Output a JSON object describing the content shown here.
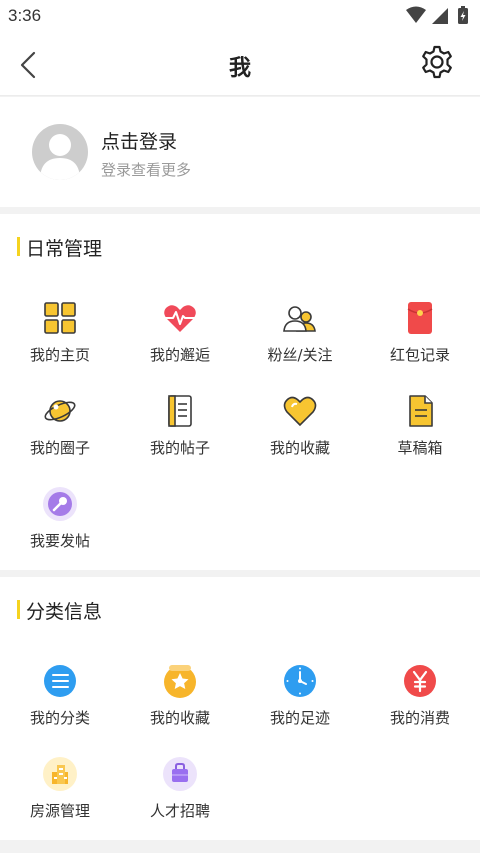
{
  "status_bar": {
    "time": "3:36"
  },
  "nav": {
    "title": "我"
  },
  "profile": {
    "login_title": "点击登录",
    "login_subtitle": "登录查看更多"
  },
  "daily": {
    "title": "日常管理",
    "items": [
      {
        "label": "我的主页",
        "icon": "homepage-grid-icon"
      },
      {
        "label": "我的邂逅",
        "icon": "heartbeat-icon"
      },
      {
        "label": "粉丝/关注",
        "icon": "followers-icon"
      },
      {
        "label": "红包记录",
        "icon": "red-envelope-icon"
      },
      {
        "label": "我的圈子",
        "icon": "planet-icon"
      },
      {
        "label": "我的帖子",
        "icon": "posts-document-icon"
      },
      {
        "label": "我的收藏",
        "icon": "heart-favorite-icon"
      },
      {
        "label": "草稿箱",
        "icon": "draft-file-icon"
      },
      {
        "label": "我要发帖",
        "icon": "microphone-icon"
      }
    ]
  },
  "classified": {
    "title": "分类信息",
    "items": [
      {
        "label": "我的分类",
        "icon": "list-category-icon"
      },
      {
        "label": "我的收藏",
        "icon": "star-favorite-icon"
      },
      {
        "label": "我的足迹",
        "icon": "clock-footprint-icon"
      },
      {
        "label": "我的消费",
        "icon": "yuan-icon"
      },
      {
        "label": "房源管理",
        "icon": "building-icon"
      },
      {
        "label": "人才招聘",
        "icon": "briefcase-icon"
      }
    ]
  },
  "colors": {
    "accent_yellow": "#f5d31f",
    "red": "#f04a4a",
    "blue": "#2e9df0",
    "purple": "#a57be8",
    "orange": "#f7b52b"
  }
}
